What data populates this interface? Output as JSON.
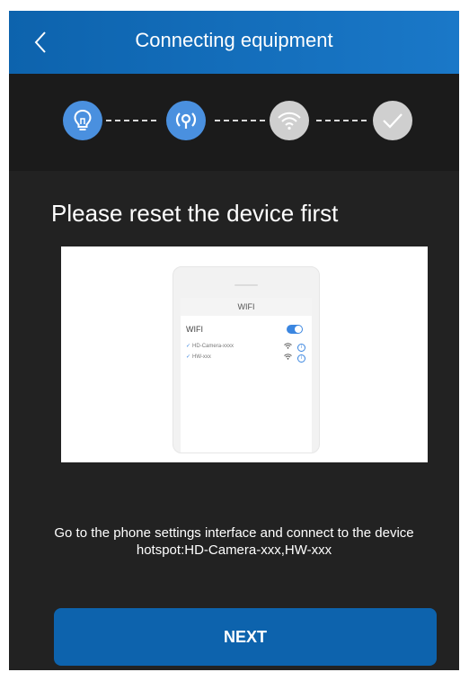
{
  "header": {
    "title": "Connecting equipment",
    "back_icon": "chevron-left-icon"
  },
  "steps": [
    {
      "icon": "lightbulb-icon",
      "state": "active"
    },
    {
      "icon": "hotspot-icon",
      "state": "active"
    },
    {
      "icon": "wifi-icon",
      "state": "inactive"
    },
    {
      "icon": "check-icon",
      "state": "inactive"
    }
  ],
  "content": {
    "heading": "Please reset the device first",
    "illustration": {
      "screen_title": "WIFI",
      "wifi_label": "WIFI",
      "networks": [
        "HD-Camera-xxxx",
        "HW-xxx"
      ]
    },
    "instruction_line1": "Go to the phone settings interface and connect to the device",
    "instruction_line2": "hotspot:HD-Camera-xxx,HW-xxx"
  },
  "footer": {
    "next_label": "NEXT"
  },
  "colors": {
    "accent": "#0d63ad",
    "step_active": "#4a90df",
    "step_inactive": "#cfcfcf",
    "background": "#1f1f1f"
  }
}
